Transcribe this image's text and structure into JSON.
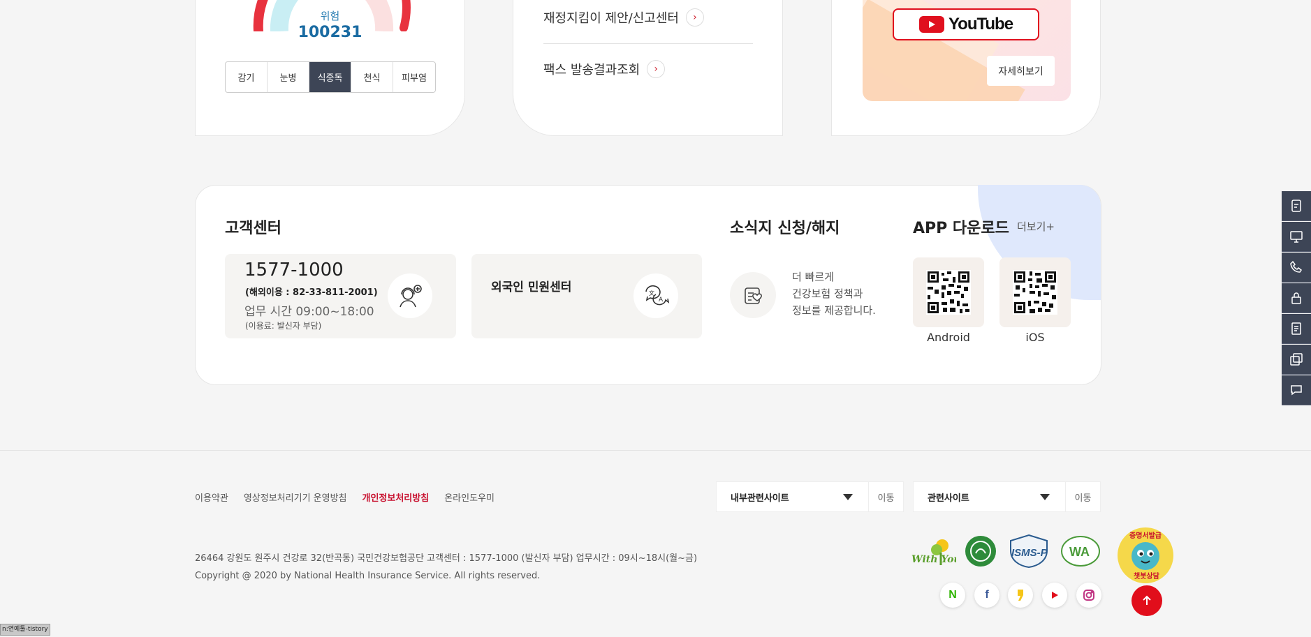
{
  "risk_card": {
    "risk_label": "위험",
    "risk_value": "100231",
    "tabs": [
      "감기",
      "눈병",
      "식중독",
      "천식",
      "피부염"
    ],
    "active_tab": "식중독"
  },
  "links_card": {
    "items": [
      "재정지킴이 제안/신고센터",
      "팩스 발송결과조회"
    ]
  },
  "youtube_card": {
    "youtube_label": "YouTube",
    "more_label": "자세히보기"
  },
  "customer_center": {
    "title": "고객센터",
    "phone": "1577-1000",
    "overseas": "(해외이용 : 82-33-811-2001)",
    "hours": "업무 시간 09:00~18:00",
    "fee": "(이용료: 발신자 부담)",
    "foreign_title": "외국인 민원센터"
  },
  "newsletter": {
    "title": "소식지 신청/해지",
    "line1": "더 빠르게",
    "line2": "건강보험 정책과",
    "line3": "정보를 제공합니다."
  },
  "app_download": {
    "title": "APP 다운로드",
    "more": "더보기+",
    "android": "Android",
    "ios": "iOS"
  },
  "footer": {
    "links": [
      "이용약관",
      "영상정보처리기기 운영방침",
      "개인정보처리방침",
      "온라인도우미"
    ],
    "select1": "내부관련사이트",
    "select2": "관련사이트",
    "go": "이동",
    "address": "26464 강원도 원주시 건강로 32(반곡동) 국민건강보험공단 고객센터 : 1577-1000 (발신자 부담) 업무시간 : 09시~18시(월~금)",
    "copyright": "Copyright @ 2020 by National Health Insurance Service. All rights reserved.",
    "cert1": "With You",
    "cert2": "ISMS-P",
    "cert3": "WA",
    "mascot_text": "증명서발급",
    "mascot_text2": "챗봇상담"
  },
  "status_bar": "n:연예툴-tistory",
  "colors": {
    "accent_red": "#e10e1b",
    "navy": "#3d4556",
    "blue_text": "#1a6ba2"
  },
  "icons": [
    "headset-icon",
    "translate-icon",
    "newsletter-heart-icon",
    "qr-icon",
    "quick-menu-icons",
    "arrow-up-icon"
  ]
}
